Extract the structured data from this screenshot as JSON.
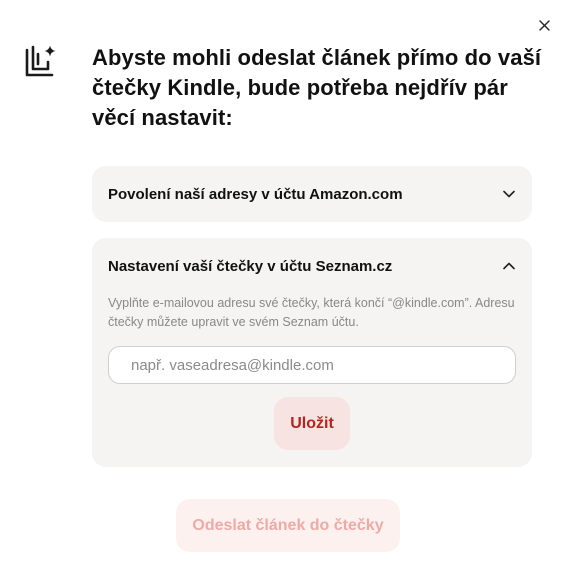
{
  "dialog": {
    "close_icon": "close-icon",
    "logo_icon": "reader-sparkle-icon",
    "title": "Abyste mohli odeslat článek přímo do vaší čtečky Kindle, bude potřeba nejdřív pár věcí nastavit:"
  },
  "sections": {
    "amazon": {
      "title": "Povolení naší adresy v účtu Amazon.com",
      "expanded": false,
      "chevron_icon": "chevron-down-icon"
    },
    "seznam": {
      "title": "Nastavení vaší čtečky v účtu Seznam.cz",
      "expanded": true,
      "chevron_icon": "chevron-up-icon",
      "description": "Vyplňte e-mailovou adresu své čtečky, která končí “@kindle.com”. Adresu čtečky můžete upravit ve svém Seznam účtu.",
      "email_placeholder": "např. vaseadresa@kindle.com",
      "email_value": "",
      "save_label": "Uložit"
    }
  },
  "footer": {
    "send_label": "Odeslat článek do čtečky"
  },
  "colors": {
    "accent": "#b3261e",
    "panel_bg": "#f5f4f3",
    "save_bg": "#f7e3e1",
    "send_bg_disabled": "#fdf1f0",
    "send_text_disabled": "#eeaaa5"
  }
}
